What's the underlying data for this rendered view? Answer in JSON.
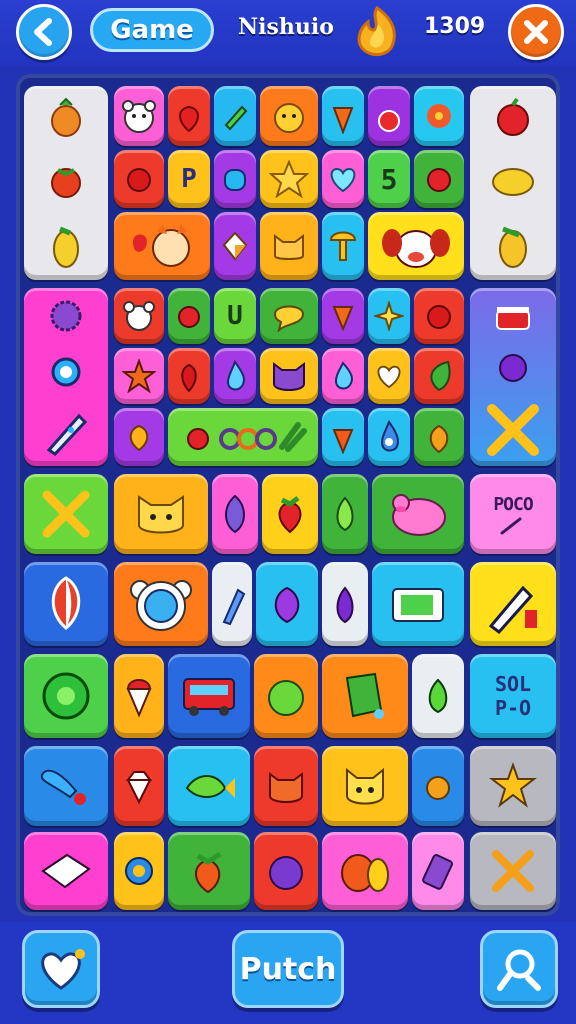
{
  "header": {
    "back_icon": "chevron-left-icon",
    "game_label": "Game",
    "player_name": "Nishuio",
    "coin_icon": "flame-coin-icon",
    "score": "1309",
    "close_icon": "close-icon"
  },
  "board": {
    "side_panel_left_top": [
      "carrot-icon",
      "tomato-icon",
      "lemon-icon"
    ],
    "side_panel_right_top": [
      "apple-icon",
      "lemon-icon",
      "lemon-icon"
    ],
    "tile_texts": {
      "p_tile": "P",
      "u_tile": "U",
      "five_tile": "5",
      "poco_tile": "POCO",
      "sol_tile_line1": "SOL",
      "sol_tile_line2": "P-O"
    }
  },
  "colors": {
    "background": "#2233b8",
    "board": "#1b2a8f",
    "accent_blue": "#27a8f2",
    "accent_orange": "#f06a16"
  },
  "footer": {
    "heart_icon": "heart-icon",
    "main_button_label": "Putch",
    "search_icon": "search-person-icon"
  }
}
